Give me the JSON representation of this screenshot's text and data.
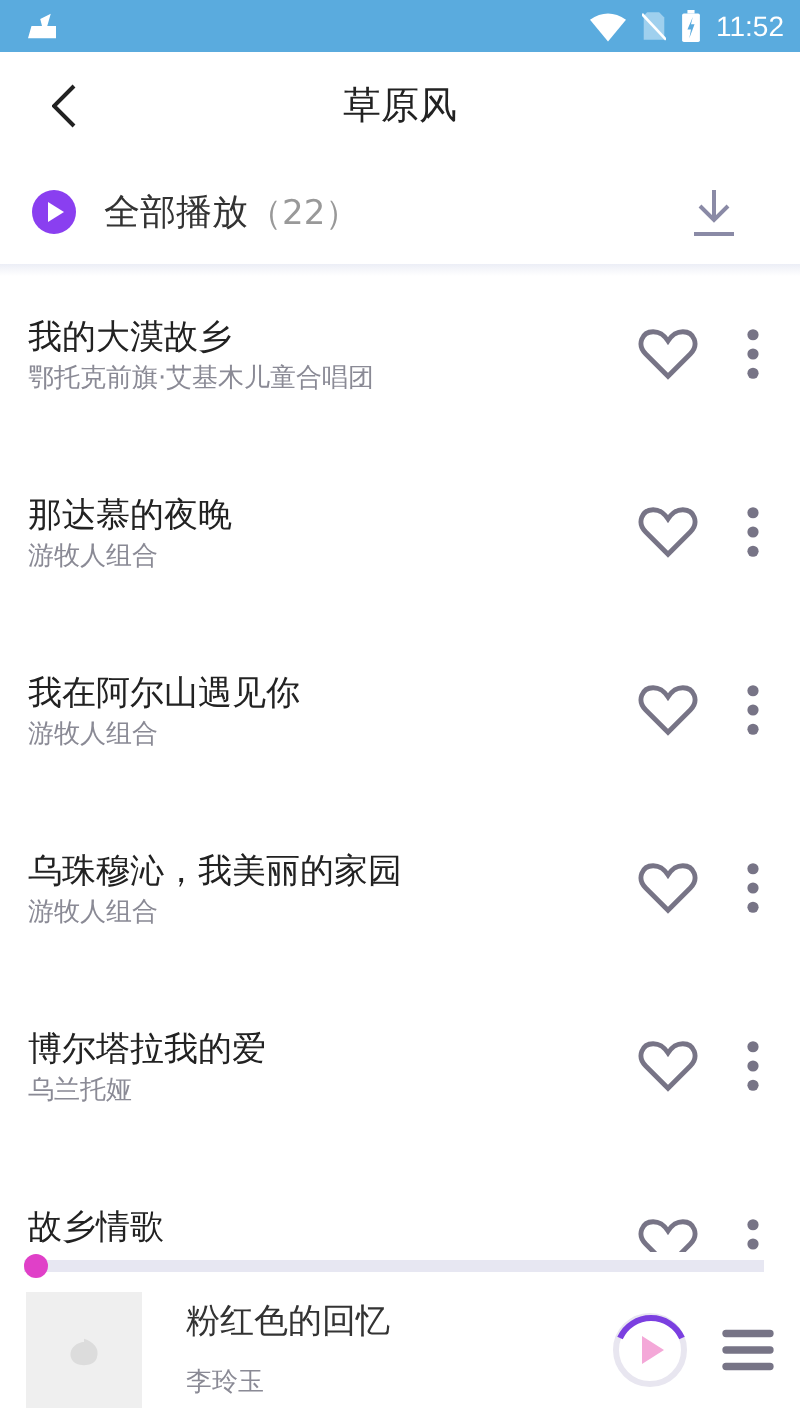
{
  "status_bar": {
    "time": "11:52"
  },
  "header": {
    "title": "草原风"
  },
  "play_all": {
    "label": "全部播放",
    "count": "（22）"
  },
  "songs": [
    {
      "title": "我的大漠故乡",
      "artist": "鄂托克前旗·艾基木儿童合唱团",
      "liked": false
    },
    {
      "title": "那达慕的夜晚",
      "artist": "游牧人组合",
      "liked": false
    },
    {
      "title": "我在阿尔山遇见你",
      "artist": "游牧人组合",
      "liked": false
    },
    {
      "title": "乌珠穆沁，我美丽的家园",
      "artist": "游牧人组合",
      "liked": false
    },
    {
      "title": "博尔塔拉我的爱",
      "artist": "乌兰托娅",
      "liked": false
    },
    {
      "title": "故乡情歌",
      "liked": false
    }
  ],
  "player": {
    "level": 0,
    "title": "粉红色的回忆",
    "artist": "李玲玉"
  }
}
